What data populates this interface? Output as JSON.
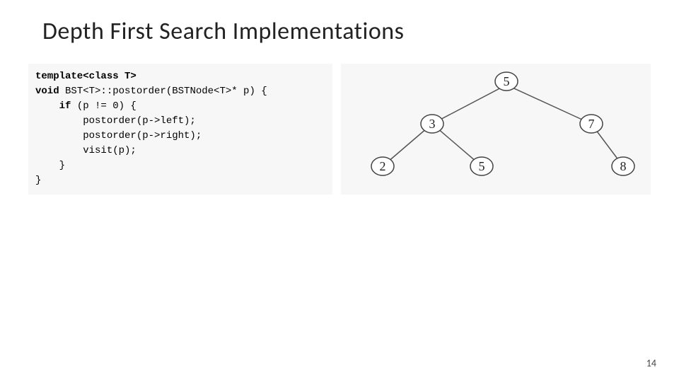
{
  "title": "Depth First Search Implementations",
  "code": {
    "l1a": "template<class T>",
    "l2a": "void",
    "l2b": " BST<T>::postorder(BSTNode<T>* p) {",
    "l3a": "    if",
    "l3b": " (p != 0) {",
    "l4": "        postorder(p->left);",
    "l5": "        postorder(p->right);",
    "l6": "        visit(p);",
    "l7": "    }",
    "l8": "}"
  },
  "tree": {
    "nodes": {
      "root": "5",
      "n3": "3",
      "n7": "7",
      "n2": "2",
      "n5b": "5",
      "n8": "8"
    }
  },
  "pageNumber": "14"
}
